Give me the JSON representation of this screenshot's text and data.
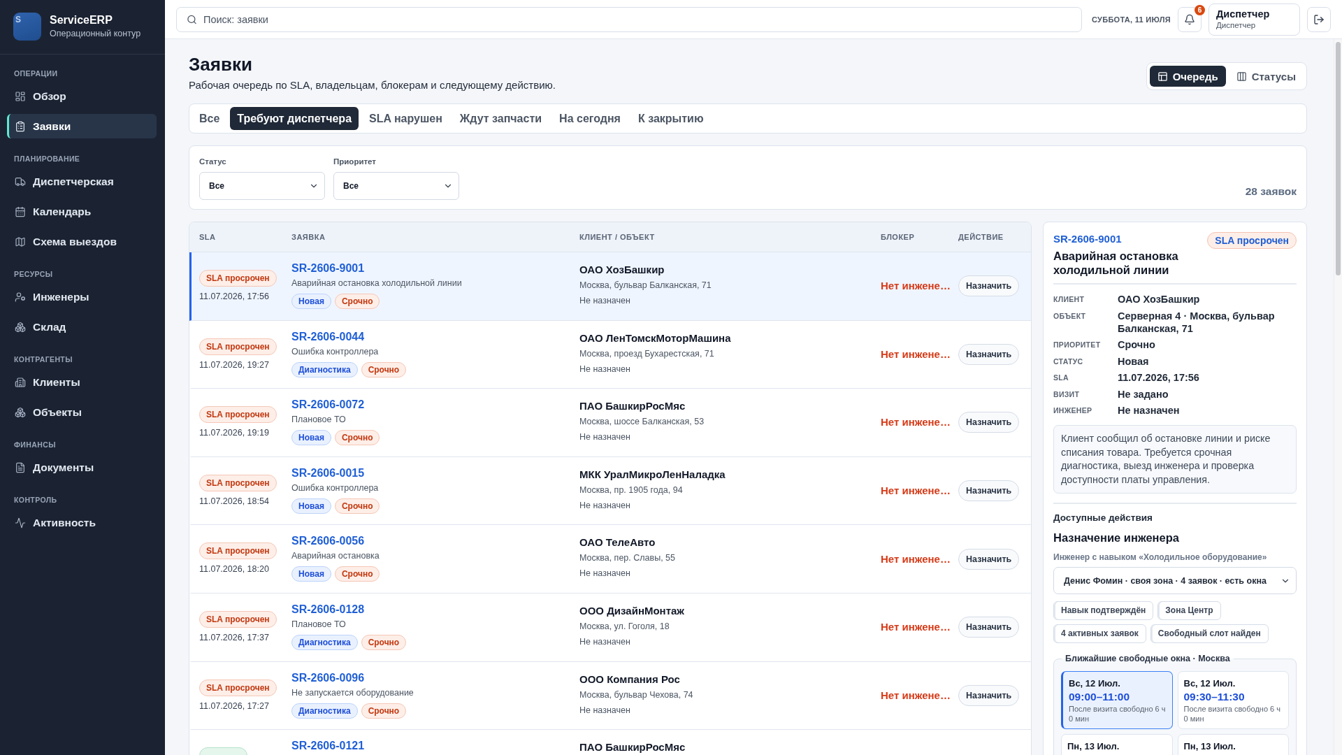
{
  "sidebar": {
    "brand": {
      "logo_letter": "S",
      "name": "ServiceERP",
      "subtitle": "Операционный контур"
    },
    "sections": [
      {
        "title": "ОПЕРАЦИИ",
        "items": [
          {
            "label": "Обзор",
            "selected": false
          },
          {
            "label": "Заявки",
            "selected": true
          }
        ]
      },
      {
        "title": "ПЛАНИРОВАНИЕ",
        "items": [
          {
            "label": "Диспетчерская",
            "selected": false
          },
          {
            "label": "Календарь",
            "selected": false
          },
          {
            "label": "Схема выездов",
            "selected": false
          }
        ]
      },
      {
        "title": "РЕСУРСЫ",
        "items": [
          {
            "label": "Инженеры",
            "selected": false
          },
          {
            "label": "Склад",
            "selected": false
          }
        ]
      },
      {
        "title": "КОНТРАГЕНТЫ",
        "items": [
          {
            "label": "Клиенты",
            "selected": false
          },
          {
            "label": "Объекты",
            "selected": false
          }
        ]
      },
      {
        "title": "ФИНАНСЫ",
        "items": [
          {
            "label": "Документы",
            "selected": false
          }
        ]
      },
      {
        "title": "КОНТРОЛЬ",
        "items": [
          {
            "label": "Активность",
            "selected": false
          }
        ]
      }
    ]
  },
  "top_bar": {
    "search": {
      "placeholder": "Поиск: заявки"
    },
    "date": "СУББОТА, 11 ИЮЛЯ",
    "notifications": "6",
    "user": {
      "name": "Диспетчер",
      "role": "Диспетчер"
    }
  },
  "page": {
    "title": "Заявки",
    "subtitle": "Рабочая очередь по SLA, владельцам, блокерам и следующему действию.",
    "views": [
      {
        "label": "Очередь",
        "selected": true
      },
      {
        "label": "Статусы",
        "selected": false
      }
    ]
  },
  "tabs": [
    {
      "label": "Все",
      "selected": false
    },
    {
      "label": "Требуют диспетчера",
      "selected": true
    },
    {
      "label": "SLA нарушен",
      "selected": false
    },
    {
      "label": "Ждут запчасти",
      "selected": false
    },
    {
      "label": "На сегодня",
      "selected": false
    },
    {
      "label": "К закрытию",
      "selected": false
    }
  ],
  "filters": {
    "fields": [
      {
        "label": "Статус",
        "value": "Все"
      },
      {
        "label": "Приоритет",
        "value": "Все"
      }
    ],
    "count": "28 заявок"
  },
  "table": {
    "columns": [
      "SLA",
      "ЗАЯВКА",
      "КЛИЕНТ / ОБЪЕКТ",
      "БЛОКЕР",
      "ДЕЙСТВИЕ"
    ],
    "rows": [
      {
        "selected": true,
        "sla": {
          "label": "SLA просрочен",
          "kind": "overdue"
        },
        "due": "11.07.2026, 17:56",
        "id": "SR-2606-9001",
        "title": "Аварийная остановка холодильной линии",
        "tags": [
          {
            "label": "Новая",
            "kind": "status"
          },
          {
            "label": "Срочно",
            "kind": "priority"
          }
        ],
        "client": "ОАО ХозБашкир",
        "address": "Москва, бульвар Балканская, 71",
        "engineer": "Не назначен",
        "blocker": "Нет инжене…",
        "action": "Назначить"
      },
      {
        "selected": false,
        "sla": {
          "label": "SLA просрочен",
          "kind": "overdue"
        },
        "due": "11.07.2026, 19:27",
        "id": "SR-2606-0044",
        "title": "Ошибка контроллера",
        "tags": [
          {
            "label": "Диагностика",
            "kind": "status"
          },
          {
            "label": "Срочно",
            "kind": "priority"
          }
        ],
        "client": "ОАО ЛенТомскМоторМашина",
        "address": "Москва, проезд Бухарестская, 71",
        "engineer": "Не назначен",
        "blocker": "Нет инжене…",
        "action": "Назначить"
      },
      {
        "selected": false,
        "sla": {
          "label": "SLA просрочен",
          "kind": "overdue"
        },
        "due": "11.07.2026, 19:19",
        "id": "SR-2606-0072",
        "title": "Плановое ТО",
        "tags": [
          {
            "label": "Новая",
            "kind": "status"
          },
          {
            "label": "Срочно",
            "kind": "priority"
          }
        ],
        "client": "ПАО БашкирРосМяс",
        "address": "Москва, шоссе Балканская, 53",
        "engineer": "Не назначен",
        "blocker": "Нет инжене…",
        "action": "Назначить"
      },
      {
        "selected": false,
        "sla": {
          "label": "SLA просрочен",
          "kind": "overdue"
        },
        "due": "11.07.2026, 18:54",
        "id": "SR-2606-0015",
        "title": "Ошибка контроллера",
        "tags": [
          {
            "label": "Новая",
            "kind": "status"
          },
          {
            "label": "Срочно",
            "kind": "priority"
          }
        ],
        "client": "МКК УралМикроЛенНаладка",
        "address": "Москва, пр. 1905 года, 94",
        "engineer": "Не назначен",
        "blocker": "Нет инжене…",
        "action": "Назначить"
      },
      {
        "selected": false,
        "sla": {
          "label": "SLA просрочен",
          "kind": "overdue"
        },
        "due": "11.07.2026, 18:20",
        "id": "SR-2606-0056",
        "title": "Аварийная остановка",
        "tags": [
          {
            "label": "Новая",
            "kind": "status"
          },
          {
            "label": "Срочно",
            "kind": "priority"
          }
        ],
        "client": "ОАО ТелеАвто",
        "address": "Москва, пер. Славы, 55",
        "engineer": "Не назначен",
        "blocker": "Нет инжене…",
        "action": "Назначить"
      },
      {
        "selected": false,
        "sla": {
          "label": "SLA просрочен",
          "kind": "overdue"
        },
        "due": "11.07.2026, 17:37",
        "id": "SR-2606-0128",
        "title": "Плановое ТО",
        "tags": [
          {
            "label": "Диагностика",
            "kind": "status"
          },
          {
            "label": "Срочно",
            "kind": "priority"
          }
        ],
        "client": "ООО ДизайнМонтаж",
        "address": "Москва, ул. Гоголя, 18",
        "engineer": "Не назначен",
        "blocker": "Нет инжене…",
        "action": "Назначить"
      },
      {
        "selected": false,
        "sla": {
          "label": "SLA просрочен",
          "kind": "overdue"
        },
        "due": "11.07.2026, 17:27",
        "id": "SR-2606-0096",
        "title": "Не запускается оборудование",
        "tags": [
          {
            "label": "Диагностика",
            "kind": "status"
          },
          {
            "label": "Срочно",
            "kind": "priority"
          }
        ],
        "client": "ООО Компания Рос",
        "address": "Москва, бульвар Чехова, 74",
        "engineer": "Не назначен",
        "blocker": "Нет инжене…",
        "action": "Назначить"
      },
      {
        "selected": false,
        "sla": {
          "kind": "ok"
        },
        "id": "SR-2606-0121",
        "client": "ПАО БашкирРосМяс"
      }
    ]
  },
  "detail": {
    "id": "SR-2606-9001",
    "badge": "SLA просрочен",
    "title": "Аварийная остановка холодильной линии",
    "fields": [
      {
        "label": "КЛИЕНТ",
        "value": "ОАО ХозБашкир"
      },
      {
        "label": "ОБЪЕКТ",
        "value": "Серверная 4 · Москва, бульвар Балканская, 71"
      },
      {
        "label": "ПРИОРИТЕТ",
        "value": "Срочно"
      },
      {
        "label": "СТАТУС",
        "value": "Новая"
      },
      {
        "label": "SLA",
        "value": "11.07.2026, 17:56"
      },
      {
        "label": "ВИЗИТ",
        "value": "Не задано"
      },
      {
        "label": "ИНЖЕНЕР",
        "value": "Не назначен"
      }
    ],
    "note": "Клиент сообщил об остановке линии и риске списания товара. Требуется срочная диагностика, выезд инженера и проверка доступности платы управления.",
    "actions_title": "Доступные действия",
    "assign": {
      "title": "Назначение инженера",
      "label": "Инженер с навыком «Холодильное оборудование»",
      "value": "Денис Фомин · своя зона · 4 заявок · есть окна",
      "chips": [
        "Навык подтверждён",
        "Зона Центр",
        "4 активных заявок",
        "Свободный слот найден"
      ],
      "slots_title": "Ближайшие свободные окна · Москва",
      "slots": [
        {
          "day": "Вс, 12 Июл.",
          "time": "09:00–11:00",
          "note": "После визита свободно 6 ч 0 мин",
          "selected": true
        },
        {
          "day": "Вс, 12 Июл.",
          "time": "09:30–11:30",
          "note": "После визита свободно 6 ч 0 мин",
          "selected": false
        },
        {
          "day": "Пн, 13 Июл.",
          "selected": false
        },
        {
          "day": "Пн, 13 Июл.",
          "selected": false
        }
      ]
    }
  }
}
